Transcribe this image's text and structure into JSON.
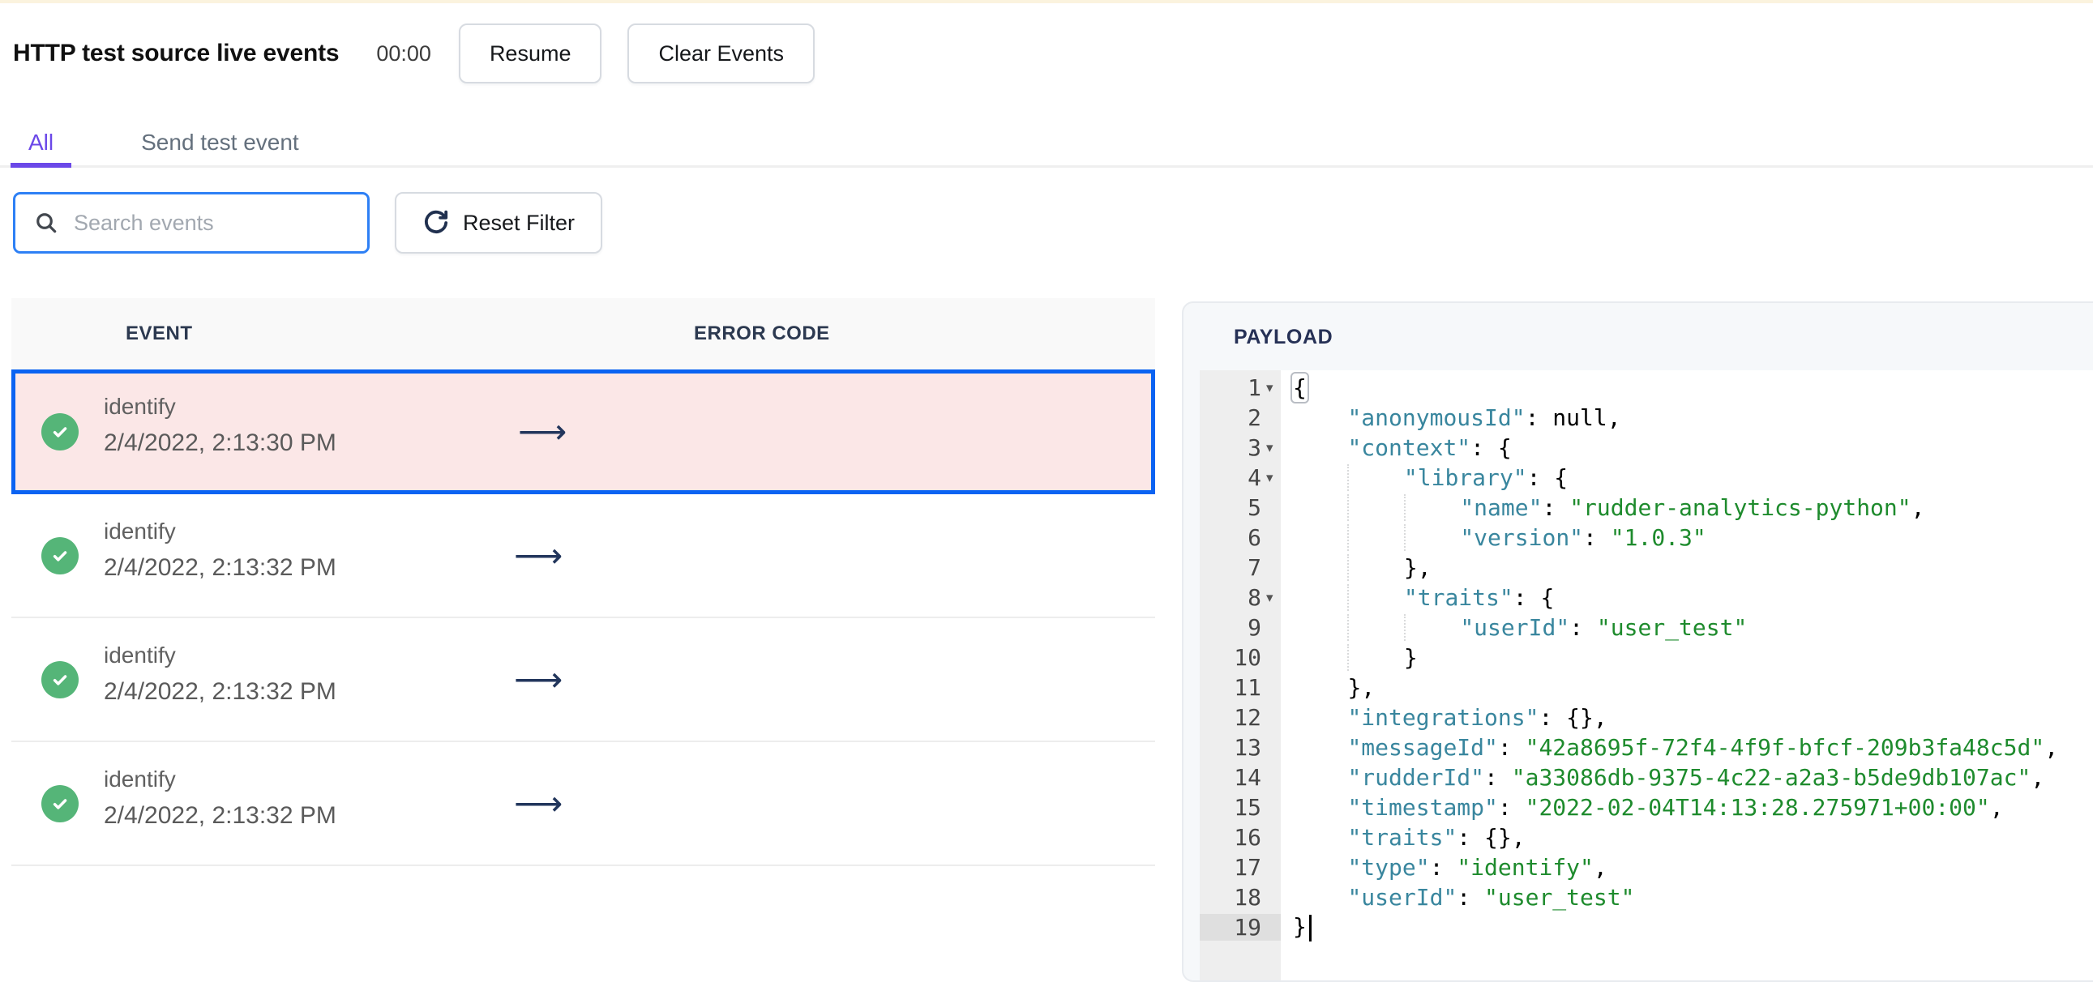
{
  "header": {
    "title": "HTTP test source live events",
    "timer": "00:00",
    "resume_label": "Resume",
    "clear_label": "Clear Events"
  },
  "tabs": [
    {
      "label": "All",
      "active": true
    },
    {
      "label": "Send test event",
      "active": false
    }
  ],
  "filters": {
    "search_placeholder": "Search events",
    "reset_label": "Reset Filter"
  },
  "event_table": {
    "columns": [
      "EVENT",
      "ERROR CODE"
    ],
    "rows": [
      {
        "event": "identify",
        "time": "2/4/2022, 2:13:30 PM",
        "status": "success",
        "selected": true
      },
      {
        "event": "identify",
        "time": "2/4/2022, 2:13:32 PM",
        "status": "success",
        "selected": false
      },
      {
        "event": "identify",
        "time": "2/4/2022, 2:13:32 PM",
        "status": "success",
        "selected": false
      },
      {
        "event": "identify",
        "time": "2/4/2022, 2:13:32 PM",
        "status": "success",
        "selected": false
      }
    ]
  },
  "payload_panel": {
    "title": "PAYLOAD",
    "lines": [
      {
        "n": 1,
        "fold": true,
        "ind": 0,
        "seg": [
          [
            "b",
            "{"
          ]
        ]
      },
      {
        "n": 2,
        "ind": 1,
        "seg": [
          [
            "k",
            "\"anonymousId\""
          ],
          [
            "p",
            ": null,"
          ]
        ]
      },
      {
        "n": 3,
        "fold": true,
        "ind": 1,
        "seg": [
          [
            "k",
            "\"context\""
          ],
          [
            "p",
            ": {"
          ]
        ]
      },
      {
        "n": 4,
        "fold": true,
        "ind": 2,
        "seg": [
          [
            "k",
            "\"library\""
          ],
          [
            "p",
            ": {"
          ]
        ]
      },
      {
        "n": 5,
        "ind": 3,
        "seg": [
          [
            "k",
            "\"name\""
          ],
          [
            "p",
            ": "
          ],
          [
            "s",
            "\"rudder-analytics-python\""
          ],
          [
            "p",
            ","
          ]
        ]
      },
      {
        "n": 6,
        "ind": 3,
        "seg": [
          [
            "k",
            "\"version\""
          ],
          [
            "p",
            ": "
          ],
          [
            "s",
            "\"1.0.3\""
          ]
        ]
      },
      {
        "n": 7,
        "ind": 2,
        "seg": [
          [
            "p",
            "},"
          ]
        ]
      },
      {
        "n": 8,
        "fold": true,
        "ind": 2,
        "seg": [
          [
            "k",
            "\"traits\""
          ],
          [
            "p",
            ": {"
          ]
        ]
      },
      {
        "n": 9,
        "ind": 3,
        "seg": [
          [
            "k",
            "\"userId\""
          ],
          [
            "p",
            ": "
          ],
          [
            "s",
            "\"user_test\""
          ]
        ]
      },
      {
        "n": 10,
        "ind": 2,
        "seg": [
          [
            "p",
            "}"
          ]
        ]
      },
      {
        "n": 11,
        "ind": 1,
        "seg": [
          [
            "p",
            "},"
          ]
        ]
      },
      {
        "n": 12,
        "ind": 1,
        "seg": [
          [
            "k",
            "\"integrations\""
          ],
          [
            "p",
            ": {},"
          ]
        ]
      },
      {
        "n": 13,
        "ind": 1,
        "seg": [
          [
            "k",
            "\"messageId\""
          ],
          [
            "p",
            ": "
          ],
          [
            "s",
            "\"42a8695f-72f4-4f9f-bfcf-209b3fa48c5d\""
          ],
          [
            "p",
            ","
          ]
        ]
      },
      {
        "n": 14,
        "ind": 1,
        "seg": [
          [
            "k",
            "\"rudderId\""
          ],
          [
            "p",
            ": "
          ],
          [
            "s",
            "\"a33086db-9375-4c22-a2a3-b5de9db107ac\""
          ],
          [
            "p",
            ","
          ]
        ]
      },
      {
        "n": 15,
        "ind": 1,
        "seg": [
          [
            "k",
            "\"timestamp\""
          ],
          [
            "p",
            ": "
          ],
          [
            "s",
            "\"2022-02-04T14:13:28.275971+00:00\""
          ],
          [
            "p",
            ","
          ]
        ]
      },
      {
        "n": 16,
        "ind": 1,
        "seg": [
          [
            "k",
            "\"traits\""
          ],
          [
            "p",
            ": {},"
          ]
        ]
      },
      {
        "n": 17,
        "ind": 1,
        "seg": [
          [
            "k",
            "\"type\""
          ],
          [
            "p",
            ": "
          ],
          [
            "s",
            "\"identify\""
          ],
          [
            "p",
            ","
          ]
        ]
      },
      {
        "n": 18,
        "ind": 1,
        "seg": [
          [
            "k",
            "\"userId\""
          ],
          [
            "p",
            ": "
          ],
          [
            "s",
            "\"user_test\""
          ]
        ]
      },
      {
        "n": 19,
        "ind": 0,
        "active": true,
        "cursor": true,
        "seg": [
          [
            "p",
            "}"
          ]
        ]
      }
    ]
  },
  "colors": {
    "accent-purple": "#6b48e8",
    "selection-blue": "#0b63f2",
    "search-border-blue": "#2e80f5",
    "success-green": "#55b578",
    "selected-row-pink": "#fbe7e7",
    "key-teal": "#39869e",
    "string-green": "#1e8b2d",
    "topstrip-cream": "#fbf3de"
  }
}
